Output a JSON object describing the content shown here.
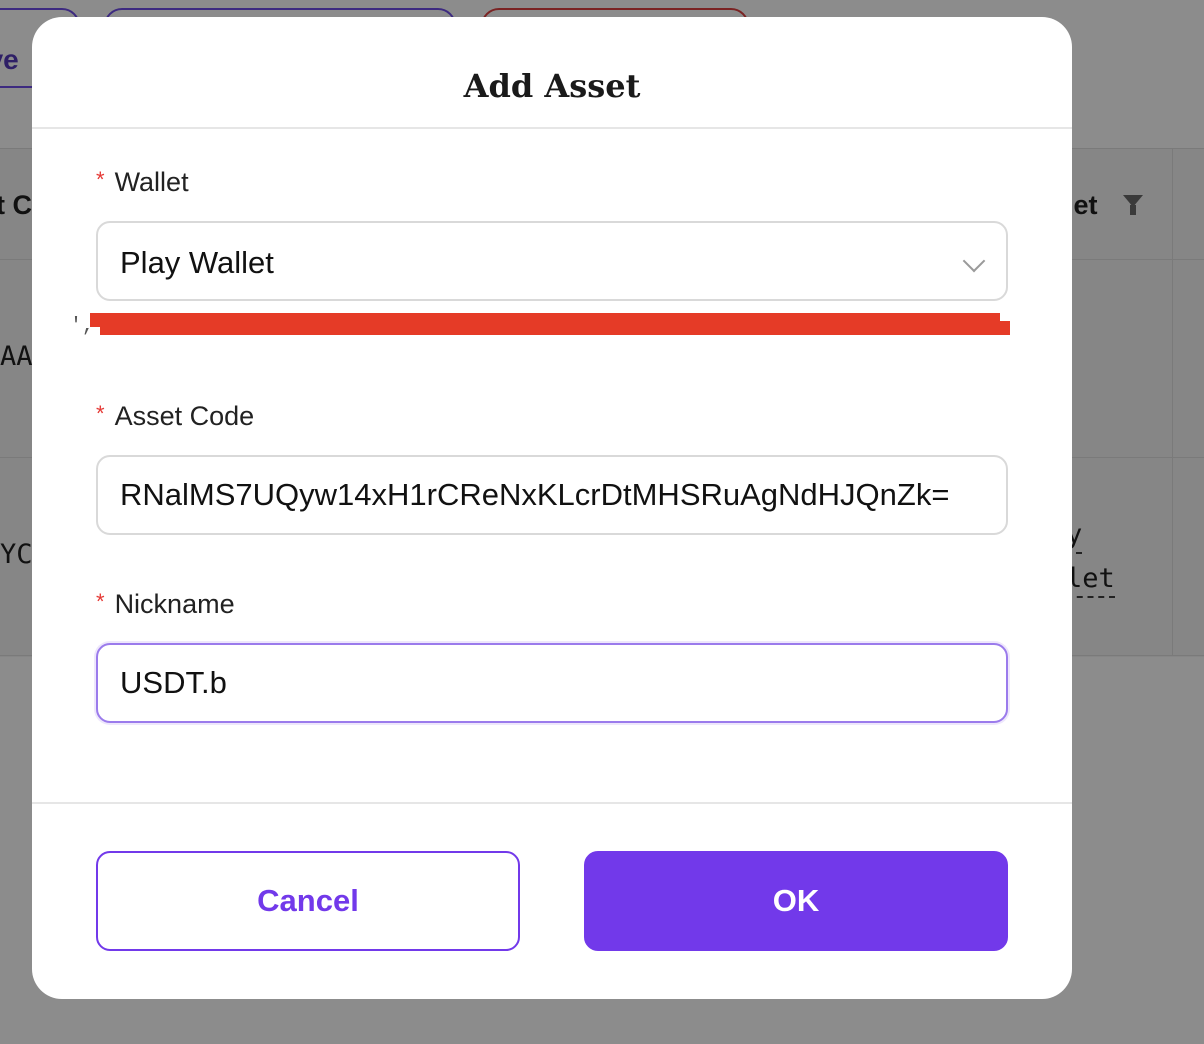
{
  "background": {
    "toolbar_fragment": "ave",
    "column_header_left": "t C",
    "column_header_right": "let",
    "row1_cell": "AA",
    "row2_cell": "YC",
    "row2_wallet_line1": "y",
    "row2_wallet_line2": "let"
  },
  "modal": {
    "title": "Add Asset",
    "wallet": {
      "label": "Wallet",
      "required_mark": "*",
      "value": "Play Wallet",
      "hint_fragment": "',"
    },
    "asset_code": {
      "label": "Asset Code",
      "required_mark": "*",
      "value": "RNalMS7UQyw14xH1rCReNxKLcrDtMHSRuAgNdHJQnZk="
    },
    "nickname": {
      "label": "Nickname",
      "required_mark": "*",
      "value": "USDT.b"
    },
    "buttons": {
      "cancel": "Cancel",
      "ok": "OK"
    }
  },
  "colors": {
    "primary": "#7239ea",
    "required": "#e53935",
    "redaction": "#e53b27",
    "overlay": "#8c8c8c"
  },
  "icons": {
    "select_chevron": "chevron-down-icon",
    "column_filter": "filter-icon"
  }
}
